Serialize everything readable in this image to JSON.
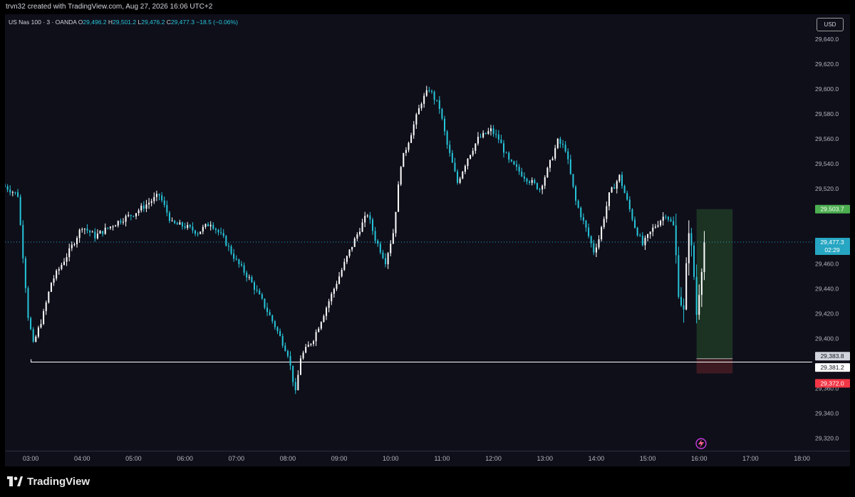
{
  "header": {
    "credit": "trvn32 created with TradingView.com, Aug 27, 2026 16:06 UTC+2"
  },
  "legend": {
    "symbol": "US Nas 100 · 3 · OANDA",
    "o_label": "O",
    "o": "29,496.2",
    "h_label": "H",
    "h": "29,501.2",
    "l_label": "L",
    "l": "29,476.2",
    "c_label": "C",
    "c": "29,477.3",
    "change": "−18.5 (−0.06%)"
  },
  "currency": "USD",
  "brand": {
    "name": "TradingView",
    "icon": "tradingview-logo-icon"
  },
  "replay_icon": "lightning-icon",
  "colors": {
    "up": "#ffffff",
    "down": "#26c6da",
    "background": "#0f0f1a",
    "target_zone": "#1e3a26",
    "stop_zone": "#3d1a22",
    "target_badge": "#4caf50",
    "stop_badge": "#f23645",
    "last_badge": "#26a6c2"
  },
  "chart_data": {
    "type": "candlestick",
    "ylim": [
      29310,
      29660
    ],
    "yticks": [
      {
        "value": 29640,
        "label": "29,640.0"
      },
      {
        "value": 29620,
        "label": "29,620.0"
      },
      {
        "value": 29600,
        "label": "29,600.0"
      },
      {
        "value": 29580,
        "label": "29,580.0"
      },
      {
        "value": 29560,
        "label": "29,560.0"
      },
      {
        "value": 29540,
        "label": "29,540.0"
      },
      {
        "value": 29520,
        "label": "29,520.0"
      },
      {
        "value": 29460,
        "label": "29,460.0"
      },
      {
        "value": 29440,
        "label": "29,440.0"
      },
      {
        "value": 29420,
        "label": "29,420.0"
      },
      {
        "value": 29400,
        "label": "29,400.0"
      },
      {
        "value": 29360,
        "label": "29,360.0"
      },
      {
        "value": 29340,
        "label": "29,340.0"
      },
      {
        "value": 29320,
        "label": "29,320.0"
      }
    ],
    "xlim": [
      "02:30",
      "18:12"
    ],
    "xticks": [
      "03:00",
      "04:00",
      "05:00",
      "06:00",
      "07:00",
      "08:00",
      "09:00",
      "10:00",
      "11:00",
      "12:00",
      "13:00",
      "14:00",
      "15:00",
      "16:00",
      "17:00",
      "18:00"
    ],
    "close_path": [
      [
        "02:30",
        29522
      ],
      [
        "02:45",
        29515
      ],
      [
        "02:57",
        29418
      ],
      [
        "03:03",
        29395
      ],
      [
        "03:15",
        29420
      ],
      [
        "03:24",
        29445
      ],
      [
        "03:45",
        29470
      ],
      [
        "04:00",
        29490
      ],
      [
        "04:15",
        29482
      ],
      [
        "04:45",
        29495
      ],
      [
        "05:00",
        29500
      ],
      [
        "05:30",
        29515
      ],
      [
        "05:45",
        29492
      ],
      [
        "06:00",
        29490
      ],
      [
        "06:15",
        29485
      ],
      [
        "06:30",
        29493
      ],
      [
        "06:45",
        29480
      ],
      [
        "07:00",
        29462
      ],
      [
        "07:15",
        29448
      ],
      [
        "07:30",
        29430
      ],
      [
        "07:45",
        29410
      ],
      [
        "08:00",
        29388
      ],
      [
        "08:09",
        29356
      ],
      [
        "08:15",
        29385
      ],
      [
        "08:30",
        29400
      ],
      [
        "08:45",
        29425
      ],
      [
        "09:00",
        29450
      ],
      [
        "09:12",
        29470
      ],
      [
        "09:24",
        29488
      ],
      [
        "09:33",
        29500
      ],
      [
        "09:42",
        29480
      ],
      [
        "09:54",
        29462
      ],
      [
        "10:03",
        29485
      ],
      [
        "10:12",
        29540
      ],
      [
        "10:24",
        29565
      ],
      [
        "10:36",
        29590
      ],
      [
        "10:45",
        29600
      ],
      [
        "10:57",
        29585
      ],
      [
        "11:06",
        29555
      ],
      [
        "11:18",
        29525
      ],
      [
        "11:30",
        29545
      ],
      [
        "11:42",
        29560
      ],
      [
        "11:57",
        29567
      ],
      [
        "12:06",
        29560
      ],
      [
        "12:18",
        29542
      ],
      [
        "12:36",
        29530
      ],
      [
        "12:54",
        29520
      ],
      [
        "13:03",
        29535
      ],
      [
        "13:15",
        29558
      ],
      [
        "13:24",
        29552
      ],
      [
        "13:36",
        29510
      ],
      [
        "13:48",
        29488
      ],
      [
        "13:57",
        29470
      ],
      [
        "14:03",
        29480
      ],
      [
        "14:15",
        29515
      ],
      [
        "14:27",
        29530
      ],
      [
        "14:36",
        29510
      ],
      [
        "14:45",
        29490
      ],
      [
        "14:54",
        29475
      ],
      [
        "15:06",
        29488
      ],
      [
        "15:21",
        29500
      ],
      [
        "15:30",
        29490
      ],
      [
        "15:36",
        29440
      ],
      [
        "15:42",
        29420
      ],
      [
        "15:48",
        29490
      ],
      [
        "15:54",
        29450
      ],
      [
        "15:57",
        29420
      ],
      [
        "16:03",
        29460
      ],
      [
        "16:06",
        29477.3
      ]
    ],
    "position": {
      "start": "15:57",
      "end": "16:39",
      "target": {
        "value": 29503.7,
        "label": "29,503.7"
      },
      "entry": {
        "value": 29383.8,
        "label": "29,383.8"
      },
      "stop": {
        "value": 29372.0,
        "label": "29,372.0"
      }
    },
    "horizontal_line": {
      "start": "03:00",
      "value": 29381.2,
      "label": "29,381.2"
    },
    "last_price": {
      "value": 29477.3,
      "label": "29,477.3",
      "countdown": "02:29"
    }
  }
}
